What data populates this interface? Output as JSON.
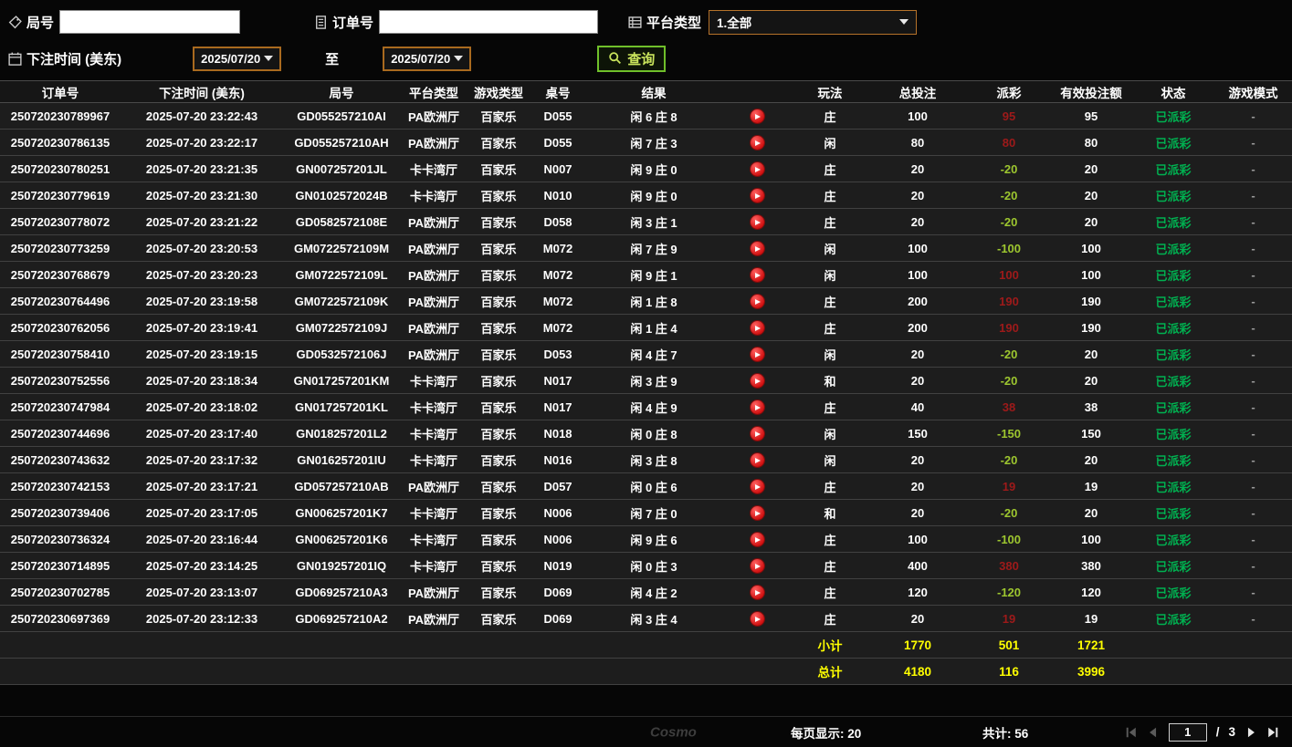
{
  "watermark": "Cosmo",
  "filters": {
    "round": {
      "label": "局号",
      "value": ""
    },
    "order": {
      "label": "订单号",
      "value": ""
    },
    "platform": {
      "label": "平台类型",
      "value": "1.全部"
    },
    "bet_time": {
      "label": "下注时间 (美东)",
      "from": "2025/07/20",
      "to_label": "至",
      "to": "2025/07/20"
    },
    "search_label": "查询"
  },
  "table": {
    "headers": [
      "订单号",
      "下注时间 (美东)",
      "局号",
      "平台类型",
      "游戏类型",
      "桌号",
      "结果",
      "",
      "玩法",
      "总投注",
      "派彩",
      "有效投注额",
      "状态",
      "游戏模式"
    ],
    "rows": [
      {
        "order": "250720230789967",
        "time": "2025-07-20 23:22:43",
        "round": "GD055257210AI",
        "platform": "PA欧洲厅",
        "game": "百家乐",
        "table": "D055",
        "result": "闲 6 庄 8",
        "bet": "庄",
        "total": "100",
        "payout": "95",
        "payout_color": "red",
        "valid": "95",
        "status": "已派彩",
        "mode": "-"
      },
      {
        "order": "250720230786135",
        "time": "2025-07-20 23:22:17",
        "round": "GD055257210AH",
        "platform": "PA欧洲厅",
        "game": "百家乐",
        "table": "D055",
        "result": "闲 7 庄 3",
        "bet": "闲",
        "total": "80",
        "payout": "80",
        "payout_color": "red",
        "valid": "80",
        "status": "已派彩",
        "mode": "-"
      },
      {
        "order": "250720230780251",
        "time": "2025-07-20 23:21:35",
        "round": "GN007257201JL",
        "platform": "卡卡湾厅",
        "game": "百家乐",
        "table": "N007",
        "result": "闲 9 庄 0",
        "bet": "庄",
        "total": "20",
        "payout": "-20",
        "payout_color": "green",
        "valid": "20",
        "status": "已派彩",
        "mode": "-"
      },
      {
        "order": "250720230779619",
        "time": "2025-07-20 23:21:30",
        "round": "GN0102572024B",
        "platform": "卡卡湾厅",
        "game": "百家乐",
        "table": "N010",
        "result": "闲 9 庄 0",
        "bet": "庄",
        "total": "20",
        "payout": "-20",
        "payout_color": "green",
        "valid": "20",
        "status": "已派彩",
        "mode": "-"
      },
      {
        "order": "250720230778072",
        "time": "2025-07-20 23:21:22",
        "round": "GD0582572108E",
        "platform": "PA欧洲厅",
        "game": "百家乐",
        "table": "D058",
        "result": "闲 3 庄 1",
        "bet": "庄",
        "total": "20",
        "payout": "-20",
        "payout_color": "green",
        "valid": "20",
        "status": "已派彩",
        "mode": "-"
      },
      {
        "order": "250720230773259",
        "time": "2025-07-20 23:20:53",
        "round": "GM0722572109M",
        "platform": "PA欧洲厅",
        "game": "百家乐",
        "table": "M072",
        "result": "闲 7 庄 9",
        "bet": "闲",
        "total": "100",
        "payout": "-100",
        "payout_color": "green",
        "valid": "100",
        "status": "已派彩",
        "mode": "-"
      },
      {
        "order": "250720230768679",
        "time": "2025-07-20 23:20:23",
        "round": "GM0722572109L",
        "platform": "PA欧洲厅",
        "game": "百家乐",
        "table": "M072",
        "result": "闲 9 庄 1",
        "bet": "闲",
        "total": "100",
        "payout": "100",
        "payout_color": "red",
        "valid": "100",
        "status": "已派彩",
        "mode": "-"
      },
      {
        "order": "250720230764496",
        "time": "2025-07-20 23:19:58",
        "round": "GM0722572109K",
        "platform": "PA欧洲厅",
        "game": "百家乐",
        "table": "M072",
        "result": "闲 1 庄 8",
        "bet": "庄",
        "total": "200",
        "payout": "190",
        "payout_color": "red",
        "valid": "190",
        "status": "已派彩",
        "mode": "-"
      },
      {
        "order": "250720230762056",
        "time": "2025-07-20 23:19:41",
        "round": "GM0722572109J",
        "platform": "PA欧洲厅",
        "game": "百家乐",
        "table": "M072",
        "result": "闲 1 庄 4",
        "bet": "庄",
        "total": "200",
        "payout": "190",
        "payout_color": "red",
        "valid": "190",
        "status": "已派彩",
        "mode": "-"
      },
      {
        "order": "250720230758410",
        "time": "2025-07-20 23:19:15",
        "round": "GD0532572106J",
        "platform": "PA欧洲厅",
        "game": "百家乐",
        "table": "D053",
        "result": "闲 4 庄 7",
        "bet": "闲",
        "total": "20",
        "payout": "-20",
        "payout_color": "green",
        "valid": "20",
        "status": "已派彩",
        "mode": "-"
      },
      {
        "order": "250720230752556",
        "time": "2025-07-20 23:18:34",
        "round": "GN017257201KM",
        "platform": "卡卡湾厅",
        "game": "百家乐",
        "table": "N017",
        "result": "闲 3 庄 9",
        "bet": "和",
        "total": "20",
        "payout": "-20",
        "payout_color": "green",
        "valid": "20",
        "status": "已派彩",
        "mode": "-"
      },
      {
        "order": "250720230747984",
        "time": "2025-07-20 23:18:02",
        "round": "GN017257201KL",
        "platform": "卡卡湾厅",
        "game": "百家乐",
        "table": "N017",
        "result": "闲 4 庄 9",
        "bet": "庄",
        "total": "40",
        "payout": "38",
        "payout_color": "red",
        "valid": "38",
        "status": "已派彩",
        "mode": "-"
      },
      {
        "order": "250720230744696",
        "time": "2025-07-20 23:17:40",
        "round": "GN018257201L2",
        "platform": "卡卡湾厅",
        "game": "百家乐",
        "table": "N018",
        "result": "闲 0 庄 8",
        "bet": "闲",
        "total": "150",
        "payout": "-150",
        "payout_color": "green",
        "valid": "150",
        "status": "已派彩",
        "mode": "-"
      },
      {
        "order": "250720230743632",
        "time": "2025-07-20 23:17:32",
        "round": "GN016257201IU",
        "platform": "卡卡湾厅",
        "game": "百家乐",
        "table": "N016",
        "result": "闲 3 庄 8",
        "bet": "闲",
        "total": "20",
        "payout": "-20",
        "payout_color": "green",
        "valid": "20",
        "status": "已派彩",
        "mode": "-"
      },
      {
        "order": "250720230742153",
        "time": "2025-07-20 23:17:21",
        "round": "GD057257210AB",
        "platform": "PA欧洲厅",
        "game": "百家乐",
        "table": "D057",
        "result": "闲 0 庄 6",
        "bet": "庄",
        "total": "20",
        "payout": "19",
        "payout_color": "red",
        "valid": "19",
        "status": "已派彩",
        "mode": "-"
      },
      {
        "order": "250720230739406",
        "time": "2025-07-20 23:17:05",
        "round": "GN006257201K7",
        "platform": "卡卡湾厅",
        "game": "百家乐",
        "table": "N006",
        "result": "闲 7 庄 0",
        "bet": "和",
        "total": "20",
        "payout": "-20",
        "payout_color": "green",
        "valid": "20",
        "status": "已派彩",
        "mode": "-"
      },
      {
        "order": "250720230736324",
        "time": "2025-07-20 23:16:44",
        "round": "GN006257201K6",
        "platform": "卡卡湾厅",
        "game": "百家乐",
        "table": "N006",
        "result": "闲 9 庄 6",
        "bet": "庄",
        "total": "100",
        "payout": "-100",
        "payout_color": "green",
        "valid": "100",
        "status": "已派彩",
        "mode": "-"
      },
      {
        "order": "250720230714895",
        "time": "2025-07-20 23:14:25",
        "round": "GN019257201IQ",
        "platform": "卡卡湾厅",
        "game": "百家乐",
        "table": "N019",
        "result": "闲 0 庄 3",
        "bet": "庄",
        "total": "400",
        "payout": "380",
        "payout_color": "red",
        "valid": "380",
        "status": "已派彩",
        "mode": "-"
      },
      {
        "order": "250720230702785",
        "time": "2025-07-20 23:13:07",
        "round": "GD069257210A3",
        "platform": "PA欧洲厅",
        "game": "百家乐",
        "table": "D069",
        "result": "闲 4 庄 2",
        "bet": "庄",
        "total": "120",
        "payout": "-120",
        "payout_color": "green",
        "valid": "120",
        "status": "已派彩",
        "mode": "-"
      },
      {
        "order": "250720230697369",
        "time": "2025-07-20 23:12:33",
        "round": "GD069257210A2",
        "platform": "PA欧洲厅",
        "game": "百家乐",
        "table": "D069",
        "result": "闲 3 庄 4",
        "bet": "庄",
        "total": "20",
        "payout": "19",
        "payout_color": "red",
        "valid": "19",
        "status": "已派彩",
        "mode": "-"
      }
    ],
    "subtotal": {
      "label": "小计",
      "total_bet": "1770",
      "payout": "501",
      "valid_bet": "1721"
    },
    "grand_total": {
      "label": "总计",
      "total_bet": "4180",
      "payout": "116",
      "valid_bet": "3996"
    }
  },
  "pagination": {
    "per_page": "每页显示: 20",
    "total_count": "共计: 56",
    "current_page": "1",
    "separator": "/",
    "total_pages": "3"
  }
}
